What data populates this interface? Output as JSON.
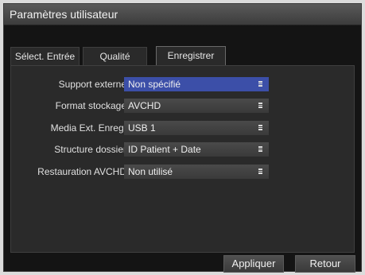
{
  "window": {
    "title": "Paramètres utilisateur"
  },
  "tabs": [
    {
      "label": "Sélect. Entrée"
    },
    {
      "label": "Qualité"
    },
    {
      "label": "Enregistrer"
    }
  ],
  "form": {
    "rows": [
      {
        "label": "Support externe",
        "value": "Non spécifié"
      },
      {
        "label": "Format stockage",
        "value": "AVCHD"
      },
      {
        "label": "Media Ext. Enreg.",
        "value": "USB 1"
      },
      {
        "label": "Structure dossier",
        "value": "ID Patient + Date"
      },
      {
        "label": "Restauration AVCHD",
        "value": "Non utilisé"
      }
    ]
  },
  "footer": {
    "apply_label": "Appliquer",
    "back_label": "Retour"
  }
}
